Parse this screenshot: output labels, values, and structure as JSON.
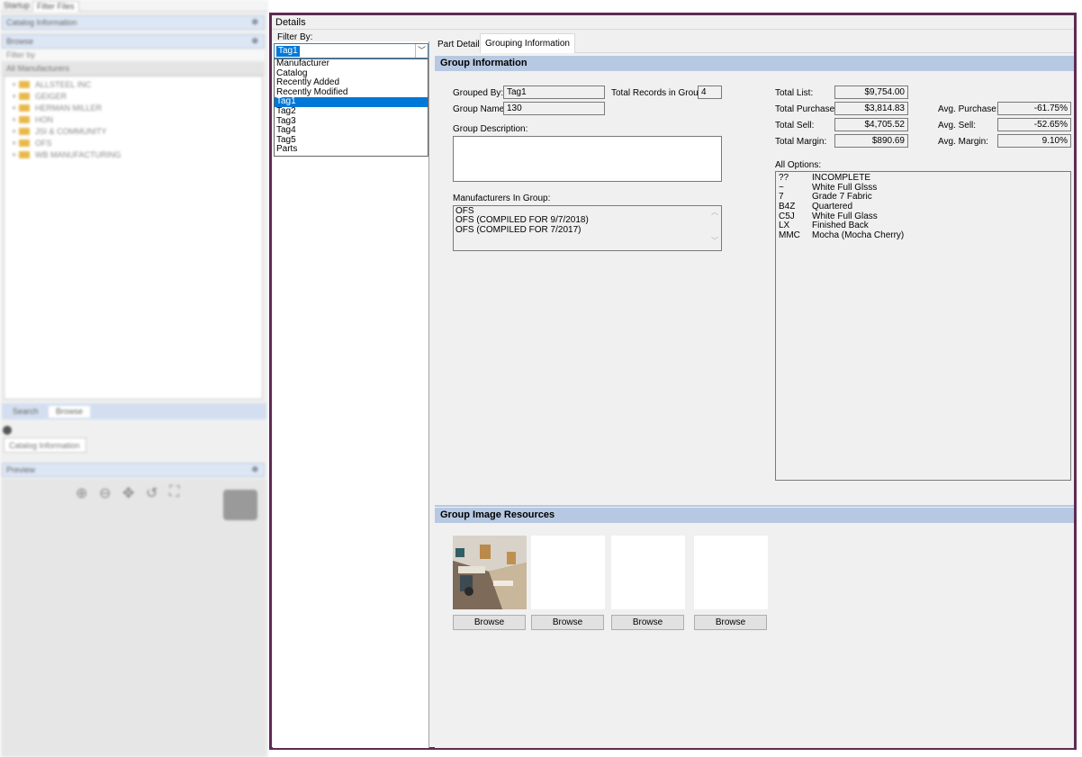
{
  "left_pane": {
    "top_tabs": [
      "Startup",
      "Filter Files"
    ],
    "catalog_info_header": "Catalog Information",
    "browse_header": "Browse",
    "filter_by_row": "Filter by",
    "all_manufacturers_row": "All Manufacturers",
    "manufacturers": [
      "ALLSTEEL INC",
      "GEIGER",
      "HERMAN MILLER",
      "HON",
      "JSI & COMMUNITY",
      "OFS",
      "WB MANUFACTURING"
    ],
    "bottom_tabs": [
      "Search",
      "Browse"
    ],
    "catalog_info_tab": "Catalog Information",
    "preview_header": "Preview",
    "pin_glyph": "⊕"
  },
  "details": {
    "title": "Details",
    "filter_label": "Filter By:",
    "filter_selected": "Tag1",
    "filter_options": [
      "Manufacturer",
      "Catalog",
      "Recently Added",
      "Recently Modified",
      "Tag1",
      "Tag2",
      "Tag3",
      "Tag4",
      "Tag5",
      "Parts"
    ],
    "tabs": [
      "Part Details",
      "Grouping Information"
    ],
    "group_info_header": "Group Information",
    "grouped_by_label": "Grouped By:",
    "grouped_by_value": "Tag1",
    "total_records_label": "Total Records in Group:",
    "total_records_value": "4",
    "group_name_label": "Group Name:",
    "group_name_value": "130",
    "group_description_label": "Group Description:",
    "group_description_value": "",
    "manufacturers_label": "Manufacturers In Group:",
    "manufacturers": [
      "OFS",
      "OFS (COMPILED FOR 9/7/2018)",
      "OFS (COMPILED FOR 7/2017)"
    ],
    "totals": {
      "list_label": "Total List:",
      "list_value": "$9,754.00",
      "purchase_label": "Total Purchase:",
      "purchase_value": "$3,814.83",
      "sell_label": "Total Sell:",
      "sell_value": "$4,705.52",
      "margin_label": "Total Margin:",
      "margin_value": "$890.69"
    },
    "averages": {
      "purchase_label": "Avg. Purchase:",
      "purchase_value": "-61.75%",
      "sell_label": "Avg. Sell:",
      "sell_value": "-52.65%",
      "margin_label": "Avg. Margin:",
      "margin_value": "9.10%"
    },
    "all_options_label": "All Options:",
    "options": [
      {
        "code": "??",
        "desc": "INCOMPLETE"
      },
      {
        "code": "~",
        "desc": "White Full Glsss"
      },
      {
        "code": "7",
        "desc": "Grade 7 Fabric"
      },
      {
        "code": "B4Z",
        "desc": "Quartered"
      },
      {
        "code": "C5J",
        "desc": "White Full Glass"
      },
      {
        "code": "LX",
        "desc": "Finished Back"
      },
      {
        "code": "MMC",
        "desc": "Mocha (Mocha Cherry)"
      }
    ],
    "image_resources_header": "Group Image Resources",
    "browse_label": "Browse",
    "frame_color": "#5e2b55",
    "selection_color": "#0078d7",
    "section_color": "#b7c9e2"
  }
}
